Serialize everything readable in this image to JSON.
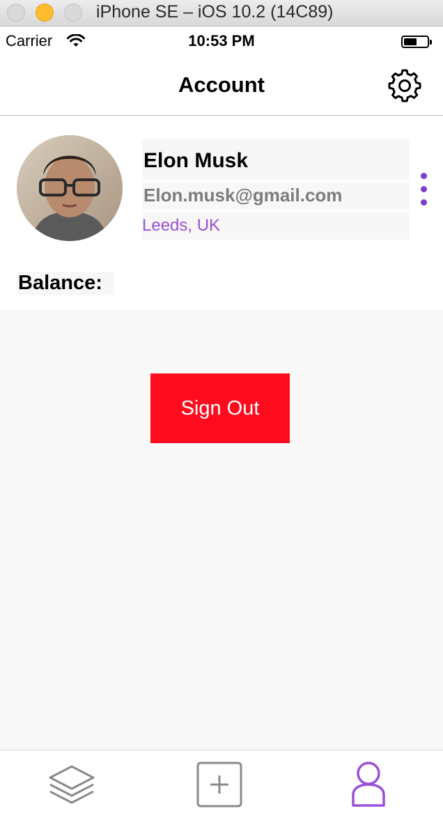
{
  "window": {
    "title": "iPhone SE – iOS 10.2 (14C89)"
  },
  "status_bar": {
    "carrier": "Carrier",
    "time": "10:53 PM"
  },
  "nav": {
    "title": "Account",
    "settings_icon": "gear-icon"
  },
  "profile": {
    "name": "Elon Musk",
    "email": "Elon.musk@gmail.com",
    "location": "Leeds, UK",
    "balance_label": "Balance:"
  },
  "actions": {
    "sign_out": "Sign Out"
  },
  "tabbar": {
    "items": [
      {
        "icon": "layers-icon",
        "selected": false
      },
      {
        "icon": "add-square-icon",
        "selected": false
      },
      {
        "icon": "person-icon",
        "selected": true
      }
    ]
  },
  "colors": {
    "accent": "#9b4fd6",
    "more_dots": "#7b3fc8",
    "sign_out_bg": "#ff0b1e",
    "tab_inactive": "#8a8a8a"
  }
}
